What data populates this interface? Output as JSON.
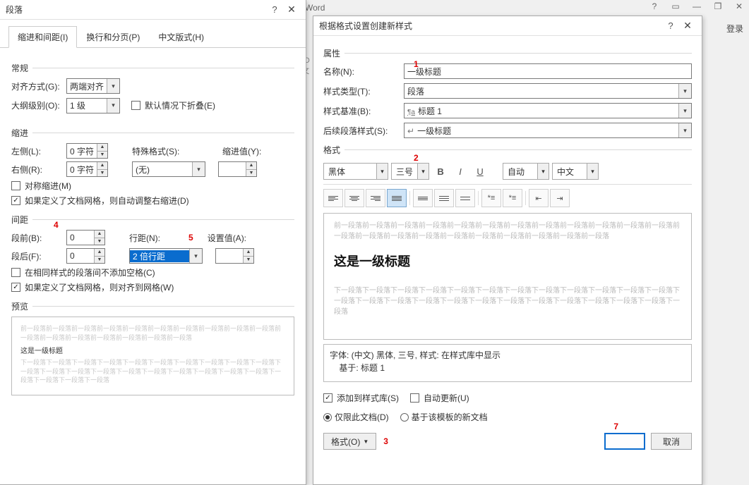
{
  "bg": {
    "word_title_suffix": "Word",
    "login": "登录",
    "style_gallery_hint": "BbCcD",
    "style_gallery_name": "↩ 正文"
  },
  "para_dialog": {
    "title": "段落",
    "tabs": [
      "缩进和间距(I)",
      "换行和分页(P)",
      "中文版式(H)"
    ],
    "section_general": "常规",
    "alignment_label": "对齐方式(G):",
    "alignment_value": "两端对齐",
    "outline_label": "大纲级别(O):",
    "outline_value": "1 级",
    "collapse_by_default": "默认情况下折叠(E)",
    "section_indent": "缩进",
    "left_label": "左侧(L):",
    "left_value": "0 字符",
    "right_label": "右侧(R):",
    "right_value": "0 字符",
    "special_label": "特殊格式(S):",
    "special_value": "(无)",
    "indent_value_label": "缩进值(Y):",
    "indent_value": "",
    "chk_mirror": "对称缩进(M)",
    "chk_grid_indent": "如果定义了文档网格，则自动调整右缩进(D)",
    "section_spacing": "间距",
    "before_label": "段前(B):",
    "before_value": "0",
    "after_label": "段后(F):",
    "after_value": "0",
    "linespacing_label": "行距(N):",
    "linespacing_value": "2 倍行距",
    "setvalue_label": "设置值(A):",
    "setvalue_value": "",
    "chk_no_space_same_style": "在相同样式的段落间不添加空格(C)",
    "chk_grid_align": "如果定义了文档网格，则对齐到网格(W)",
    "section_preview": "预览",
    "preview_grey_before": "前一段落前一段落前一段落前一段落前一段落前一段落前一段落前一段落前一段落前一段落前一段落前一段落前一段落前一段落前一段落前一段落前一段落",
    "preview_text": "这是一级标题",
    "preview_grey_after": "下一段落下一段落下一段落下一段落下一段落下一段落下一段落下一段落下一段落下一段落下一段落下一段落下一段落下一段落下一段落下一段落下一段落下一段落下一段落下一段落下一段落下一段落下一段落下一段落"
  },
  "style_dialog": {
    "title": "根据格式设置创建新样式",
    "group_properties": "属性",
    "name_label": "名称(N):",
    "name_value": "一级标题",
    "type_label": "样式类型(T):",
    "type_value": "段落",
    "basedon_label": "样式基准(B):",
    "basedon_value": "标题 1",
    "basedon_prefix": "¶a",
    "following_label": "后续段落样式(S):",
    "following_value": "一级标题",
    "following_prefix": "↵",
    "group_format": "格式",
    "font_name": "黑体",
    "font_size": "三号",
    "auto_color": "自动",
    "lang": "中文",
    "sample_grey_before": "前一段落前一段落前一段落前一段落前一段落前一段落前一段落前一段落前一段落前一段落前一段落前一段落前一段落前一段落前一段落前一段落前一段落前一段落前一段落前一段落前一段落前一段落",
    "sample_title": "这是一级标题",
    "sample_grey_after": "下一段落下一段落下一段落下一段落下一段落下一段落下一段落下一段落下一段落下一段落下一段落下一段落下一段落下一段落下一段落下一段落下一段落下一段落下一段落下一段落下一段落下一段落下一段落下一段落下一段落",
    "desc_line1": "字体: (中文) 黑体, 三号, 样式: 在样式库中显示",
    "desc_line2": "    基于: 标题 1",
    "chk_addtogallery": "添加到样式库(S)",
    "chk_autoupdate": "自动更新(U)",
    "radio_thisdoc": "仅限此文档(D)",
    "radio_template": "基于该模板的新文档",
    "format_button": "格式(O)",
    "cancel_button": "取消"
  },
  "annotations": {
    "a1": "1",
    "a2": "2",
    "a3": "3",
    "a4": "4",
    "a5": "5",
    "a7": "7"
  }
}
